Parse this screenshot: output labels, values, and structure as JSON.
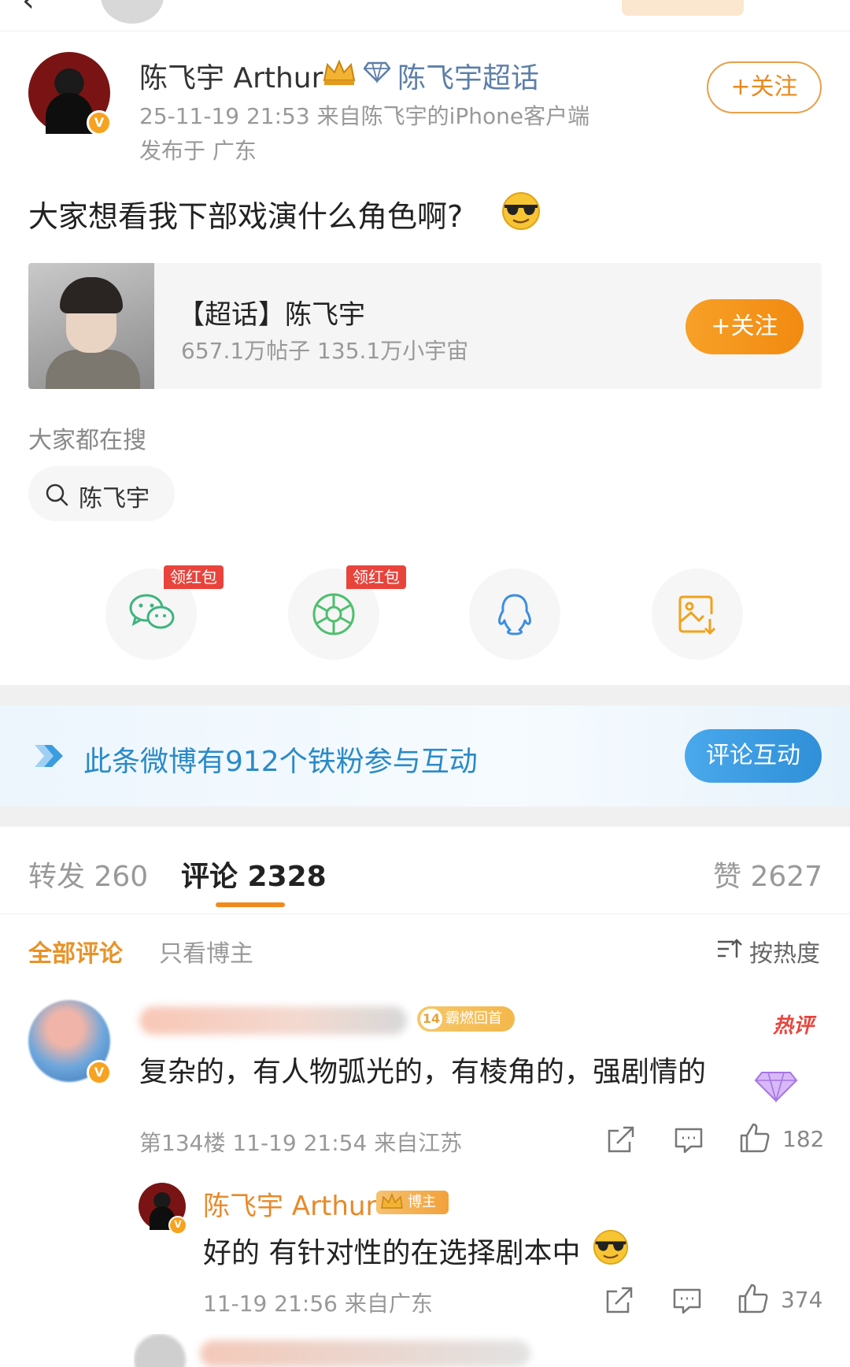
{
  "post": {
    "author": "陈飞宇 Arthur",
    "topic_link": "陈飞宇超话",
    "timestamp_source": "25-11-19 21:53  来自陈飞宇的iPhone客户端",
    "location": "发布于 广东",
    "follow_label": "+关注",
    "text": "大家想看我下部戏演什么角色啊?",
    "emoji": "sunglasses-emoji"
  },
  "topic_card": {
    "title": "【超话】陈飞宇",
    "stats": "657.1万帖子 135.1万小宇宙",
    "follow_label": "+关注"
  },
  "search": {
    "label": "大家都在搜",
    "chip": "陈飞宇"
  },
  "share": {
    "redpacket_label": "领红包",
    "items": [
      "wechat-icon",
      "moments-icon",
      "qq-icon",
      "save-image-icon"
    ]
  },
  "fan_banner": {
    "text": "此条微博有912个铁粉参与互动",
    "button": "评论互动"
  },
  "tabs": {
    "repost": "转发 260",
    "comments": "评论 2328",
    "likes": "赞 2627"
  },
  "filters": {
    "all": "全部评论",
    "owner_only": "只看博主",
    "sort": "按热度"
  },
  "comment1": {
    "medal_level": "14",
    "medal_text": "霸燃回首",
    "hot_tag": "热评",
    "text": "复杂的，有人物弧光的，有棱角的，强剧情的",
    "meta": "第134楼 11-19 21:54 来自江苏",
    "likes": "182"
  },
  "reply": {
    "author": "陈飞宇 Arthur",
    "owner_tag": "博主",
    "text": "好的 有针对性的在选择剧本中",
    "meta": "11-19 21:56 来自广东",
    "likes": "374"
  },
  "colors": {
    "accent_orange": "#f08a1c",
    "link_blue": "#5d7fa8",
    "banner_blue": "#2a8ac8",
    "redpacket": "#e8443c"
  }
}
